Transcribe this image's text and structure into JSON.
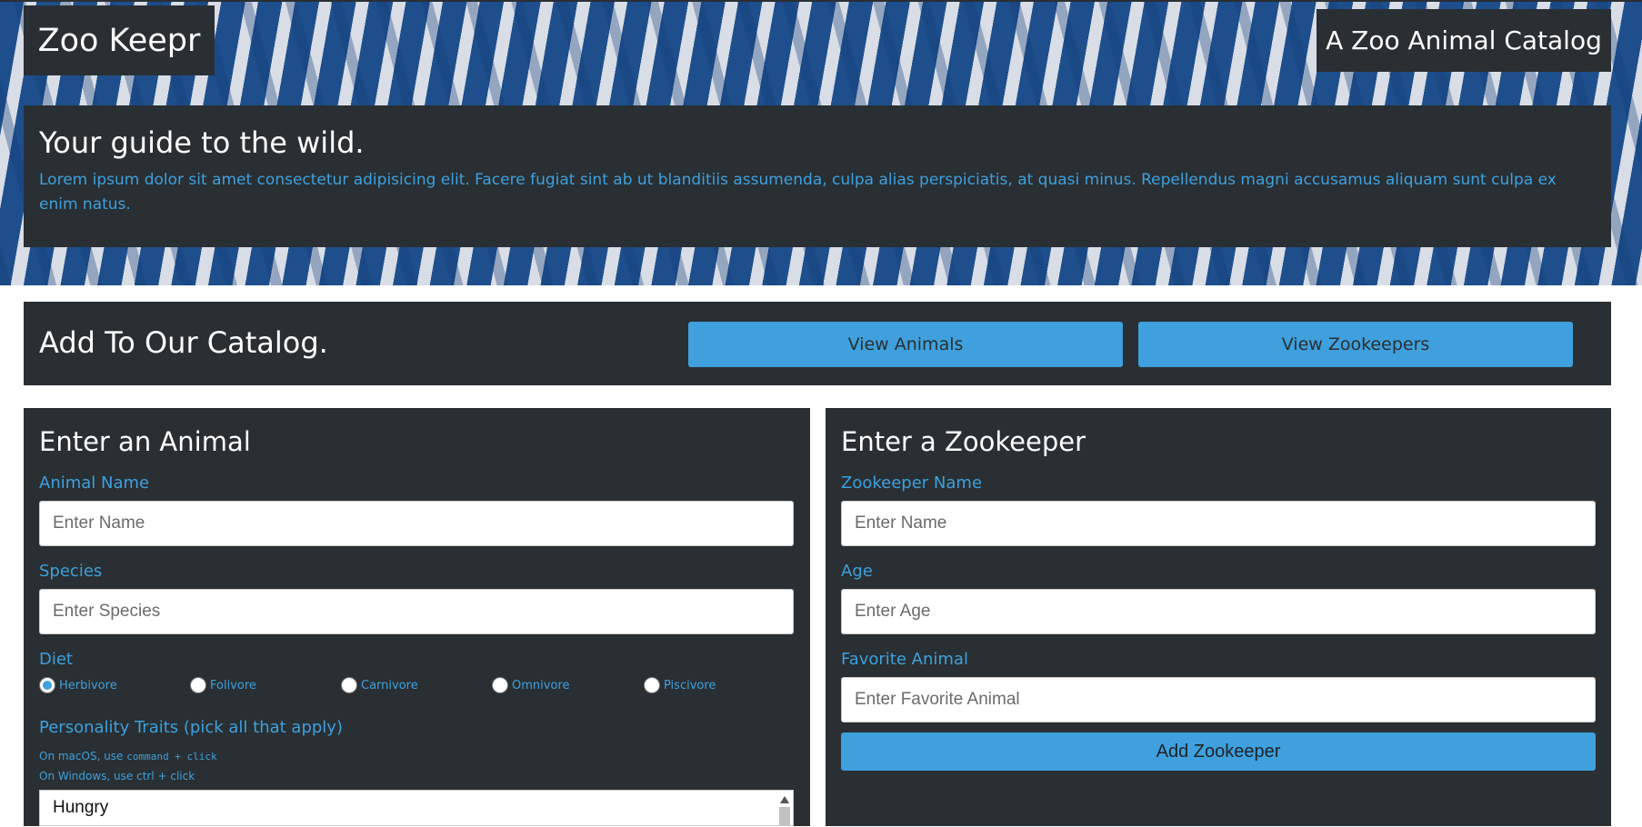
{
  "header": {
    "logo": "Zoo Keepr",
    "tagline": "A Zoo Animal Catalog"
  },
  "intro": {
    "title": "Your guide to the wild.",
    "text": "Lorem ipsum dolor sit amet consectetur adipisicing elit. Facere fugiat sint ab ut blanditiis assumenda, culpa alias perspiciatis, at quasi minus. Repellendus magni accusamus aliquam sunt culpa ex enim natus."
  },
  "catalog": {
    "title": "Add To Our Catalog.",
    "view_animals": "View Animals",
    "view_zookeepers": "View Zookeepers"
  },
  "animal_form": {
    "title": "Enter an Animal",
    "name_label": "Animal Name",
    "name_placeholder": "Enter Name",
    "species_label": "Species",
    "species_placeholder": "Enter Species",
    "diet_label": "Diet",
    "diet_options": [
      "Herbivore",
      "Folivore",
      "Carnivore",
      "Omnivore",
      "Piscivore"
    ],
    "diet_selected": "Herbivore",
    "traits_label": "Personality Traits (pick all that apply)",
    "hint_mac_prefix": "On macOS, use ",
    "hint_mac_code": "command + click",
    "hint_windows": "On Windows, use ctrl + click",
    "traits_first_option": "Hungry"
  },
  "zookeeper_form": {
    "title": "Enter a Zookeeper",
    "name_label": "Zookeeper Name",
    "name_placeholder": "Enter Name",
    "age_label": "Age",
    "age_placeholder": "Enter Age",
    "favorite_label": "Favorite Animal",
    "favorite_placeholder": "Enter Favorite Animal",
    "submit": "Add Zookeeper"
  },
  "colors": {
    "panel": "#292f33",
    "accent": "#3fa0dd"
  }
}
